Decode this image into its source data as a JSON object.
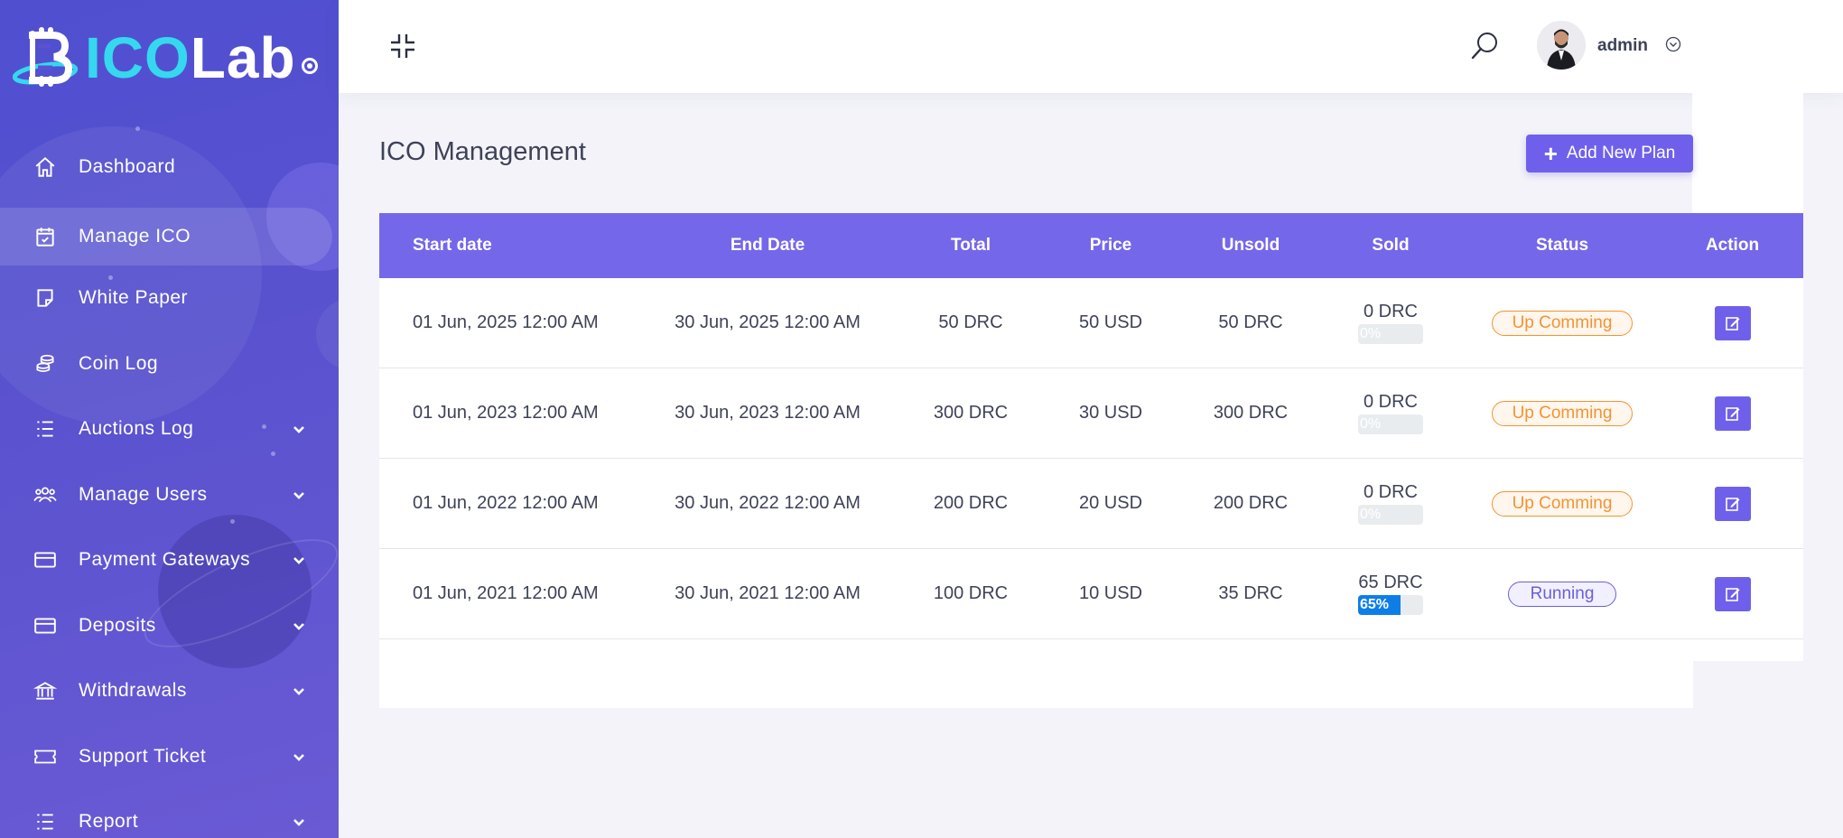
{
  "brand": {
    "part1": "ICO",
    "part2": "Lab"
  },
  "sidebar": {
    "items": [
      {
        "label": "Dashboard",
        "icon": "home-icon",
        "active": false,
        "expandable": false
      },
      {
        "label": "Manage ICO",
        "icon": "calendar-check-icon",
        "active": true,
        "expandable": false
      },
      {
        "label": "White Paper",
        "icon": "sticky-note-icon",
        "active": false,
        "expandable": false
      },
      {
        "label": "Coin Log",
        "icon": "coins-icon",
        "active": false,
        "expandable": false
      },
      {
        "label": "Auctions Log",
        "icon": "list-icon",
        "active": false,
        "expandable": true
      },
      {
        "label": "Manage Users",
        "icon": "users-icon",
        "active": false,
        "expandable": true
      },
      {
        "label": "Payment Gateways",
        "icon": "credit-card-icon",
        "active": false,
        "expandable": true
      },
      {
        "label": "Deposits",
        "icon": "credit-card-icon",
        "active": false,
        "expandable": true
      },
      {
        "label": "Withdrawals",
        "icon": "bank-icon",
        "active": false,
        "expandable": true
      },
      {
        "label": "Support Ticket",
        "icon": "ticket-icon",
        "active": false,
        "expandable": true
      },
      {
        "label": "Report",
        "icon": "list-icon",
        "active": false,
        "expandable": true
      }
    ]
  },
  "header": {
    "user_name": "admin",
    "collapse_icon": "compress-icon",
    "search_icon": "search-icon"
  },
  "main": {
    "title": "ICO Management",
    "add_button_label": "Add New Plan",
    "table": {
      "columns": [
        "Start date",
        "End Date",
        "Total",
        "Price",
        "Unsold",
        "Sold",
        "Status",
        "Action"
      ],
      "rows": [
        {
          "start": "01 Jun, 2025 12:00 AM",
          "end": "30 Jun, 2025 12:00 AM",
          "total": "50 DRC",
          "price": "50 USD",
          "unsold": "50 DRC",
          "sold": "0 DRC",
          "progress": 0,
          "progress_label": "0%",
          "status": "Up Comming",
          "status_type": "upcoming"
        },
        {
          "start": "01 Jun, 2023 12:00 AM",
          "end": "30 Jun, 2023 12:00 AM",
          "total": "300 DRC",
          "price": "30 USD",
          "unsold": "300 DRC",
          "sold": "0 DRC",
          "progress": 0,
          "progress_label": "0%",
          "status": "Up Comming",
          "status_type": "upcoming"
        },
        {
          "start": "01 Jun, 2022 12:00 AM",
          "end": "30 Jun, 2022 12:00 AM",
          "total": "200 DRC",
          "price": "20 USD",
          "unsold": "200 DRC",
          "sold": "0 DRC",
          "progress": 0,
          "progress_label": "0%",
          "status": "Up Comming",
          "status_type": "upcoming"
        },
        {
          "start": "01 Jun, 2021 12:00 AM",
          "end": "30 Jun, 2021 12:00 AM",
          "total": "100 DRC",
          "price": "10 USD",
          "unsold": "35 DRC",
          "sold": "65 DRC",
          "progress": 65,
          "progress_label": "65%",
          "status": "Running",
          "status_type": "running"
        }
      ]
    }
  },
  "colors": {
    "sidebar": "#5a52cf",
    "accent": "#7567ea",
    "button": "#6f60eb",
    "progress": "#0d7ee8",
    "upcoming": "#f39330",
    "running": "#6a5fd8",
    "logo_cyan": "#35d8ee"
  }
}
